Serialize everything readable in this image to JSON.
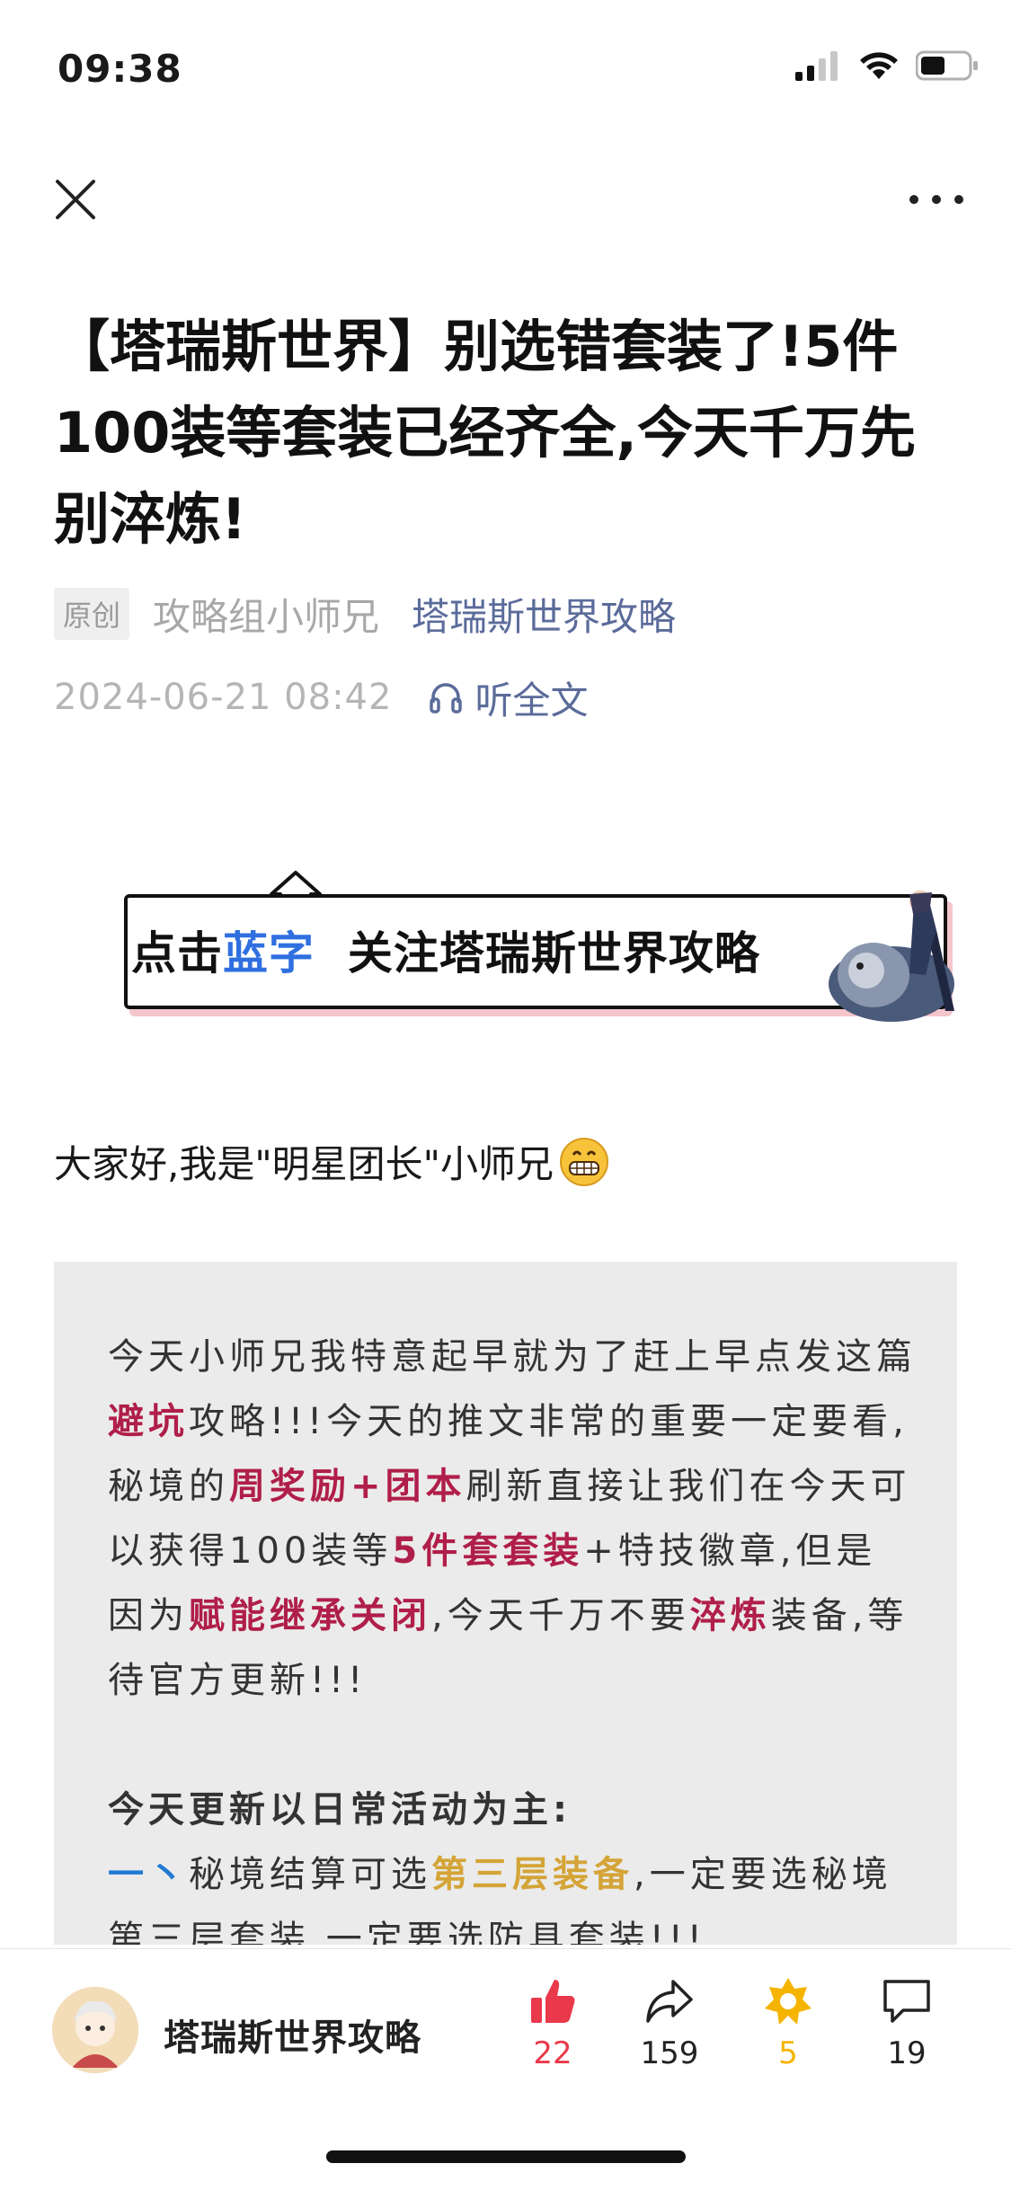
{
  "status_bar": {
    "time": "09:38"
  },
  "article": {
    "title": "【塔瑞斯世界】别选错套装了!5件100装等套装已经齐全,今天千万先别淬炼!",
    "original_badge": "原创",
    "author": "攻略组小师兄",
    "account": "塔瑞斯世界攻略",
    "date": "2024-06-21 08:42",
    "listen_label": "听全文"
  },
  "banner": {
    "part1": "点击",
    "part2": "蓝字",
    "part3": "关注塔瑞斯世界攻略"
  },
  "greeting": "大家好,我是\"明星团长\"小师兄",
  "content": {
    "p1_a": "今天小师兄我特意起早就为了赶上早点发这篇",
    "p1_hl1": "避坑",
    "p1_b": "攻略!!!今天的推文非常的重要一定要看,秘境的",
    "p1_hl2": "周奖励+团本",
    "p1_c": "刷新直接让我们在今天可以获得100装等",
    "p1_hl3": "5件套套装",
    "p1_d": "+特技徽章,但是因为",
    "p1_hl4": "赋能继承关闭",
    "p1_e": ",今天千万不要",
    "p1_hl5": "淬炼",
    "p1_f": "装备,等待官方更新!!!",
    "section_title": "今天更新以日常活动为主:",
    "item1_num": "一丶",
    "item1_a": "秘境结算可选",
    "item1_hl": "第三层装备",
    "item1_b": ",一定要选秘境第三层套装,一定要选防具套装!!!"
  },
  "bottom_bar": {
    "account_name": "塔瑞斯世界攻略",
    "like_count": "22",
    "share_count": "159",
    "star_count": "5",
    "comment_count": "19"
  },
  "colors": {
    "accent_link": "#5b6b9a",
    "highlight_red": "#b01e4a",
    "highlight_gold": "#d4a437",
    "like_red": "#e9394b",
    "star_gold": "#f5b400"
  }
}
